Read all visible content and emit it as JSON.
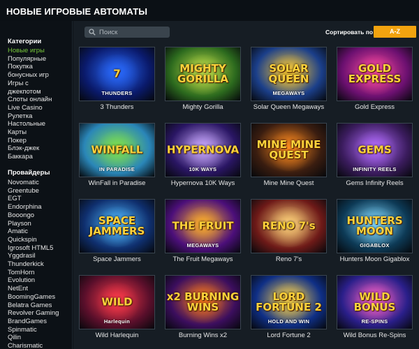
{
  "header": {
    "title": "НОВЫЕ ИГРОВЫЕ АВТОМАТЫ"
  },
  "sidebar": {
    "categories_heading": "Категории",
    "categories": [
      {
        "label": "Новые игры",
        "active": true
      },
      {
        "label": "Популярные"
      },
      {
        "label": "Покупка"
      },
      {
        "label": "бонусных игр"
      },
      {
        "label": "Игры с"
      },
      {
        "label": "джекпотом"
      },
      {
        "label": "Слоты онлайн"
      },
      {
        "label": "Live Casino"
      },
      {
        "label": "Рулетка"
      },
      {
        "label": "Настольные"
      },
      {
        "label": "Карты"
      },
      {
        "label": "Покер"
      },
      {
        "label": "Блэк-джек"
      },
      {
        "label": "Баккара"
      }
    ],
    "providers_heading": "Провайдеры",
    "providers": [
      "Novomatic",
      "Greentube",
      "EGT",
      "Endorphina",
      "Booongo",
      "Playson",
      "Amatic",
      "Quickspin",
      "Igrosoft HTML5",
      "Yggdrasil",
      "Thunderkick",
      "TomHorn",
      "Evolution",
      "NetEnt",
      "BoomingGames",
      "Belatra Games",
      "Revolver Gaming",
      "BrandGames",
      "Spinmatic",
      "Qilin",
      "Charismatic"
    ]
  },
  "search": {
    "placeholder": "Поиск"
  },
  "sort": {
    "label": "Сортировать по:",
    "button": "A-Z"
  },
  "games": [
    {
      "name": "3 Thunders",
      "logo": "7",
      "sub": "THUNDERS",
      "bg": "#0a1a6b",
      "glow": "#2a6bff"
    },
    {
      "name": "Mighty Gorilla",
      "logo": "MIGHTY GORILLA",
      "sub": "",
      "bg": "#2c6a1e",
      "glow": "#c2e04a"
    },
    {
      "name": "Solar Queen Megaways",
      "logo": "SOLAR QUEEN",
      "sub": "MEGAWAYS",
      "bg": "#1b3f8a",
      "glow": "#ffcc33"
    },
    {
      "name": "Gold Express",
      "logo": "GOLD EXPRESS",
      "sub": "",
      "bg": "#6b1070",
      "glow": "#ff4aa0"
    },
    {
      "name": "WinFall in Paradise",
      "logo": "WINFALL",
      "sub": "IN PARADISE",
      "bg": "#2a86b8",
      "glow": "#7fe14b"
    },
    {
      "name": "Hypernova 10K Ways",
      "logo": "HYPERNOVA",
      "sub": "10K WAYS",
      "bg": "#2a1664",
      "glow": "#c9a8ff"
    },
    {
      "name": "Mine Mine Quest",
      "logo": "MINE MINE QUEST",
      "sub": "",
      "bg": "#3a1d10",
      "glow": "#ff8a1f"
    },
    {
      "name": "Gems Infinity Reels",
      "logo": "GEMS",
      "sub": "INFINITY REELS",
      "bg": "#3b1c5e",
      "glow": "#b36cff"
    },
    {
      "name": "Space Jammers",
      "logo": "SPACE JAMMERS",
      "sub": "",
      "bg": "#0f2f6e",
      "glow": "#4fb8ff"
    },
    {
      "name": "The Fruit Megaways",
      "logo": "THE FRUIT",
      "sub": "MEGAWAYS",
      "bg": "#4c0f7a",
      "glow": "#ffb02a"
    },
    {
      "name": "Reno 7's",
      "logo": "RENO 7's",
      "sub": "",
      "bg": "#6e1a18",
      "glow": "#ffd37a"
    },
    {
      "name": "Hunters Moon Gigablox",
      "logo": "HUNTERS MOON",
      "sub": "GIGABLOX",
      "bg": "#0d3a56",
      "glow": "#7fd8ff"
    },
    {
      "name": "Wild Harlequin",
      "logo": "WILD",
      "sub": "Harlequin",
      "bg": "#5a0f2b",
      "glow": "#ff3a4a"
    },
    {
      "name": "Burning Wins x2",
      "logo": "x2 BURNING WINS",
      "sub": "",
      "bg": "#3c0e5e",
      "glow": "#ff7a1a"
    },
    {
      "name": "Lord Fortune 2",
      "logo": "LORD FORTUNE 2",
      "sub": "HOLD AND WIN",
      "bg": "#0f2f86",
      "glow": "#ffd54a"
    },
    {
      "name": "Wild Bonus Re-Spins",
      "logo": "WILD BONUS",
      "sub": "RE-SPINS",
      "bg": "#2a1f8a",
      "glow": "#ff62c8"
    }
  ]
}
